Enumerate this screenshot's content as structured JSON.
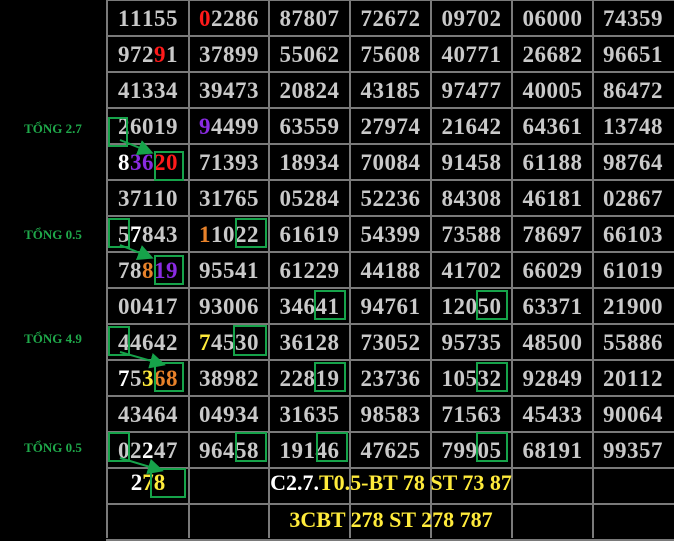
{
  "rows": [
    [
      "11155",
      "02286",
      "87807",
      "72672",
      "09702",
      "06000",
      "74359"
    ],
    [
      "97291",
      "37899",
      "55062",
      "75608",
      "40771",
      "26682",
      "96651"
    ],
    [
      "41334",
      "39473",
      "20824",
      "43185",
      "97477",
      "40005",
      "86472"
    ],
    [
      "26019",
      "94499",
      "63559",
      "27974",
      "21642",
      "64361",
      "13748"
    ],
    [
      "83620",
      "71393",
      "18934",
      "70084",
      "91458",
      "61188",
      "98764"
    ],
    [
      "37110",
      "31765",
      "05284",
      "52236",
      "84308",
      "46181",
      "02867"
    ],
    [
      "57843",
      "11022",
      "61619",
      "54399",
      "73588",
      "78697",
      "66103"
    ],
    [
      "78819",
      "95541",
      "61229",
      "44188",
      "41702",
      "66029",
      "61019"
    ],
    [
      "00417",
      "93006",
      "34641",
      "94761",
      "12050",
      "63371",
      "21900"
    ],
    [
      "44642",
      "74530",
      "36128",
      "73052",
      "95735",
      "48500",
      "55886"
    ],
    [
      "75368",
      "38982",
      "22819",
      "23736",
      "10532",
      "92849",
      "20112"
    ],
    [
      "43464",
      "04934",
      "31635",
      "98583",
      "71563",
      "45433",
      "90064"
    ],
    [
      "02247",
      "96458",
      "19146",
      "47625",
      "79905",
      "68191",
      "99357"
    ]
  ],
  "labels": [
    "TỔNG 2.7",
    "TỔNG 0.5",
    "TỔNG 4.9",
    "TỔNG 0.5"
  ],
  "bottom": {
    "result_prefix": "2",
    "result_highlight": "78",
    "line1_white": "C2.7.",
    "line1_yellow": "T0.5-BT 78 ST 73 87",
    "line2": "3CBT 278 ST 278 787"
  },
  "colors": {
    "cell_text": "#c9c9c9",
    "red": "#ff1a1a",
    "purple": "#8a2be2",
    "orange": "#e8822a",
    "yellow": "#ffeb3b",
    "white": "#ffffff",
    "green_box": "#16a34a",
    "red_box": "#e11d1d"
  },
  "colored_digits": [
    {
      "row": 0,
      "col": 1,
      "idx": 0,
      "color": "red"
    },
    {
      "row": 1,
      "col": 0,
      "idx": 3,
      "color": "red"
    },
    {
      "row": 3,
      "col": 1,
      "idx": 0,
      "color": "purple"
    },
    {
      "row": 4,
      "col": 0,
      "idx": 0,
      "color": "white"
    },
    {
      "row": 4,
      "col": 0,
      "idx": 1,
      "color": "purple"
    },
    {
      "row": 4,
      "col": 0,
      "idx": 2,
      "color": "purple"
    },
    {
      "row": 4,
      "col": 0,
      "idx": 3,
      "color": "red"
    },
    {
      "row": 4,
      "col": 0,
      "idx": 4,
      "color": "red"
    },
    {
      "row": 6,
      "col": 0,
      "idx": 1,
      "color": "white"
    },
    {
      "row": 6,
      "col": 1,
      "idx": 0,
      "color": "orange"
    },
    {
      "row": 7,
      "col": 0,
      "idx": 2,
      "color": "orange"
    },
    {
      "row": 7,
      "col": 0,
      "idx": 3,
      "color": "purple"
    },
    {
      "row": 7,
      "col": 0,
      "idx": 4,
      "color": "purple"
    },
    {
      "row": 9,
      "col": 1,
      "idx": 0,
      "color": "yellow"
    },
    {
      "row": 10,
      "col": 0,
      "idx": 0,
      "color": "white"
    },
    {
      "row": 10,
      "col": 0,
      "idx": 2,
      "color": "yellow"
    },
    {
      "row": 10,
      "col": 0,
      "idx": 3,
      "color": "orange"
    },
    {
      "row": 10,
      "col": 0,
      "idx": 4,
      "color": "orange"
    },
    {
      "row": 12,
      "col": 0,
      "idx": 2,
      "color": "white"
    }
  ]
}
